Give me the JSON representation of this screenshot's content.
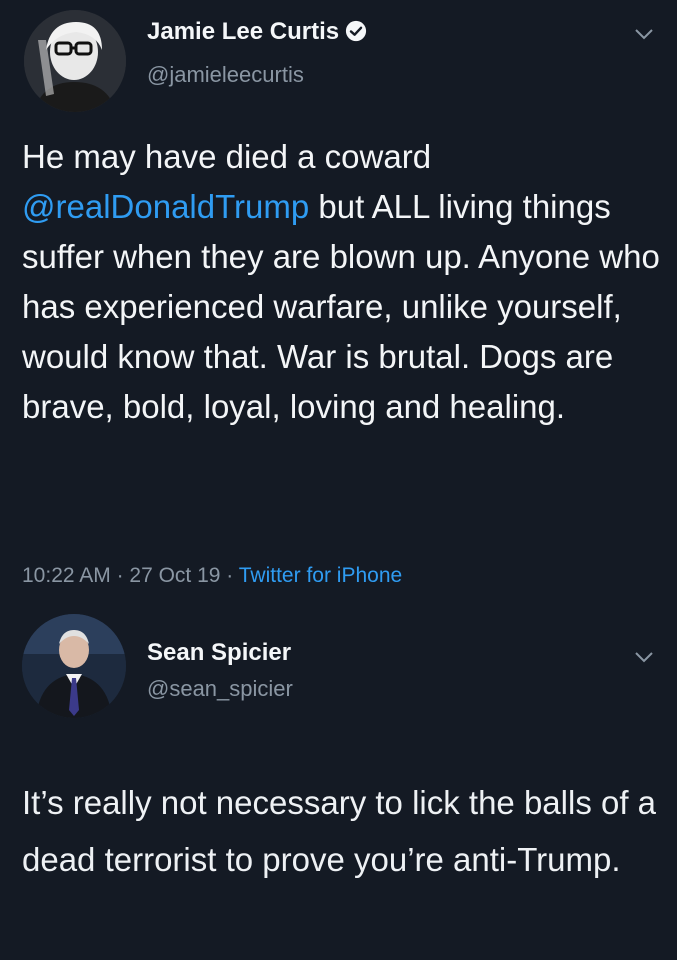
{
  "tweet1": {
    "author_name": "Jamie Lee Curtis",
    "handle": "@jamieleecurtis",
    "text_before": "He may have died a coward ",
    "mention": "@realDonaldTrump",
    "text_after": " but ALL living things suffer when they are blown up. Anyone who has experienced warfare, unlike yourself, would know that. War is brutal. Dogs are brave, bold, loyal, loving and healing.",
    "time": "10:22 AM",
    "separator": " · ",
    "date": "27 Oct 19",
    "source": "Twitter for iPhone",
    "verified": true
  },
  "tweet2": {
    "author_name": "Sean Spicier",
    "handle": "@sean_spicier",
    "text": "It’s really not necessary to lick the balls of a dead terrorist to prove you’re anti-Trump."
  },
  "icons": {
    "verified": "verified-badge-icon",
    "menu": "chevron-down-icon"
  },
  "colors": {
    "background": "#141a24",
    "link": "#2f9cf2",
    "muted": "#8a96a3"
  }
}
